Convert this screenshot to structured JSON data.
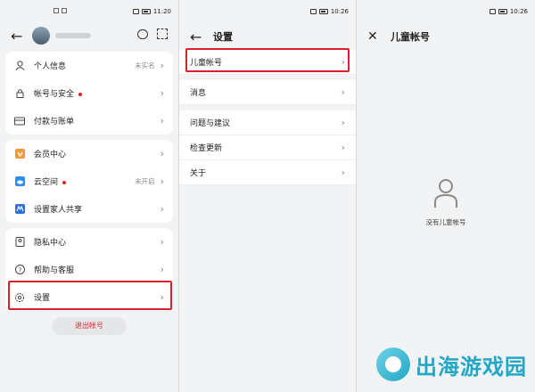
{
  "status": {
    "left_time": "11:20",
    "mid_time": "10:26",
    "right_time": "10:26"
  },
  "account_panel": {
    "items_group1": [
      {
        "label": "个人信息",
        "value": "未实名",
        "icon": "person-icon"
      },
      {
        "label": "帐号与安全",
        "dot": true,
        "icon": "lock-icon"
      },
      {
        "label": "付款与账单",
        "icon": "card-icon"
      }
    ],
    "items_group2": [
      {
        "label": "会员中心",
        "icon": "vip-icon"
      },
      {
        "label": "云空间",
        "dot": true,
        "value": "未开启",
        "icon": "cloud-icon"
      },
      {
        "label": "设置家人共享",
        "icon": "family-icon"
      }
    ],
    "items_group3": [
      {
        "label": "隐私中心",
        "icon": "privacy-icon"
      },
      {
        "label": "帮助与客服",
        "icon": "help-icon"
      }
    ],
    "settings_label": "设置",
    "logout_label": "退出帐号"
  },
  "settings_panel": {
    "title": "设置",
    "items": [
      {
        "label": "儿童帐号"
      },
      {
        "label": "消息"
      },
      {
        "label": "问题与建议"
      },
      {
        "label": "检查更新"
      },
      {
        "label": "关于"
      }
    ]
  },
  "child_panel": {
    "title": "儿童帐号",
    "empty_text": "没有儿童帐号"
  },
  "brand": {
    "text": "出海游戏园"
  },
  "colors": {
    "accent_red": "#d9202b",
    "brand_cyan": "#22a7c7"
  }
}
